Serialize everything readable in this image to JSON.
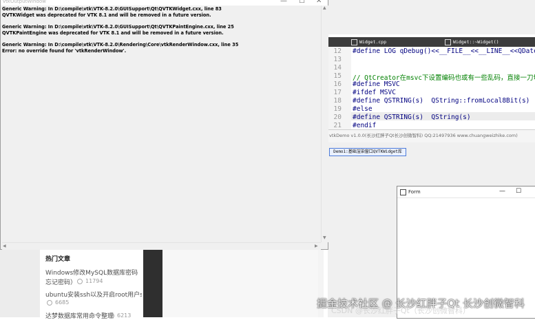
{
  "vtk_window": {
    "title": "vtkOutputWindow",
    "controls": {
      "minimize": "—",
      "maximize": "☐",
      "close": "✕"
    },
    "lines": [
      "Generic Warning: In D:\\compile\\vtk\\VTK-8.2.0\\GUISupport\\Qt\\QVTKWidget.cxx, line 83",
      "QVTKWidget was deprecated for VTK 8.1 and will be removed in a future version.",
      "",
      "Generic Warning: In D:\\compile\\vtk\\VTK-8.2.0\\GUISupport\\Qt\\QVTKPaintEngine.cxx, line 25",
      "QVTKPaintEngine was deprecated for VTK 8.1 and will be removed in a future version.",
      "",
      "Generic Warning: In D:\\compile\\vtk\\VTK-8.2.0\\Rendering\\Core\\vtkRenderWindow.cxx, line 35",
      "Error: no override found for 'vtkRenderWindow'."
    ]
  },
  "editor": {
    "tabs": [
      "Widget.cpp",
      "Widget::~Widget()"
    ],
    "lines": [
      {
        "n": "12",
        "text": "#define LOG qDebug()<<__FILE__<<__LINE__<<QDateTi",
        "style": "kw"
      },
      {
        "n": "13",
        "text": "",
        "style": ""
      },
      {
        "n": "14",
        "text": "",
        "style": ""
      },
      {
        "n": "15",
        "text": "// QtCreator在msvc下设置编码也或有一些乱码，直接一刀切",
        "style": "cm"
      },
      {
        "n": "16",
        "text": "#define MSVC",
        "style": "kw"
      },
      {
        "n": "17",
        "text": "#ifdef MSVC",
        "style": "kw"
      },
      {
        "n": "18",
        "text": "#define QSTRING(s)  QString::fromLocal8Bit(s)",
        "style": "kw"
      },
      {
        "n": "19",
        "text": "#else",
        "style": "kw"
      },
      {
        "n": "20",
        "text": "#define QSTRING(s)  QString(s)",
        "style": "kw"
      },
      {
        "n": "21",
        "text": "#endif",
        "style": "kw"
      }
    ]
  },
  "demo": {
    "title": "vtkDemo v1.0.0(长沙红胖子Qt长沙创微智科) QQ:21497936 www.chuangweizhike.com)",
    "tab_label": "Demo1:基础渲染窗口QVTKWidget库"
  },
  "form": {
    "title": "Form",
    "controls": {
      "minimize": "—",
      "maximize": "☐"
    }
  },
  "blog": {
    "section_title": "热门文章",
    "articles": [
      {
        "title": "Windows修改MySQL数据库密码（修",
        "title2": "忘记密码）",
        "views": "11794"
      },
      {
        "title": "ubuntu安装ssh以及开启root用户ssh",
        "title2": "",
        "views": "6685"
      },
      {
        "title": "达梦数据库常用命令整理",
        "title2": "",
        "views": "6213"
      }
    ]
  },
  "watermark": {
    "line1": "掘金技术社区 @ 长沙红胖子Qt 长沙创微智科",
    "line2": "CSDN @长沙红胖子Qt（长沙创微智科）"
  }
}
